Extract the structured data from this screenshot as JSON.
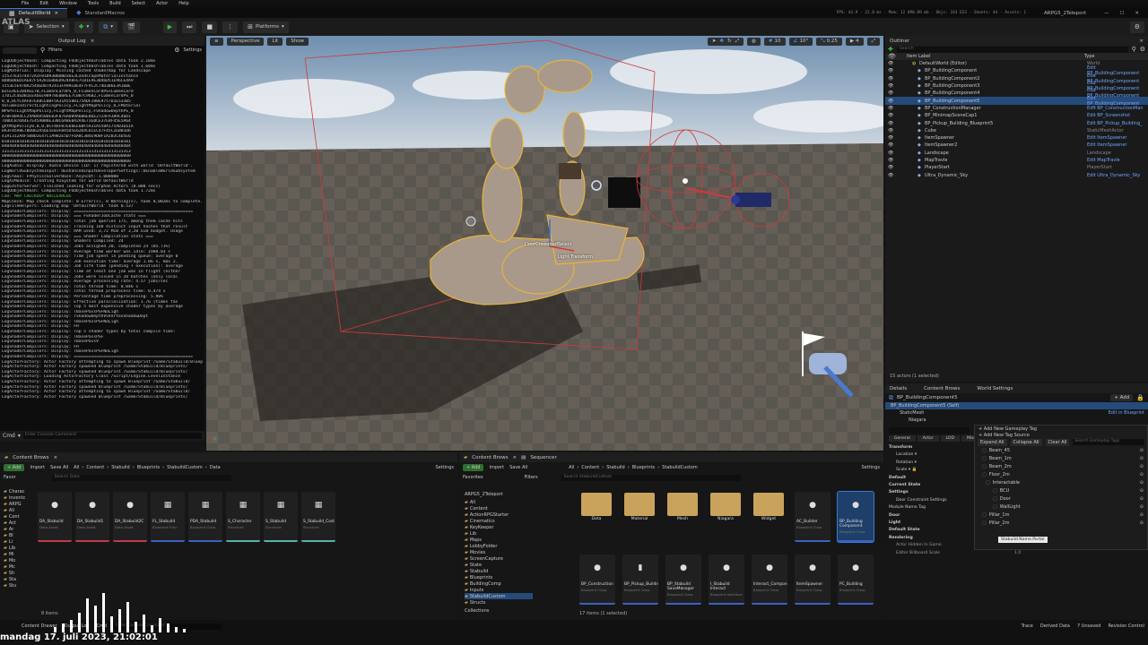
{
  "menu": [
    "File",
    "Edit",
    "Window",
    "Tools",
    "Build",
    "Select",
    "Actor",
    "Help"
  ],
  "tabs": {
    "level": "DefaultWorld",
    "macros": "StandardMacros"
  },
  "project": "ARPG5_2Teleport",
  "stats": "FPS: 43.9 · 22.8 ms · Mem: 12 090.89 mb · Objs: 243 623 · Sheets: 44 · Assets: 1",
  "toolbar": {
    "platforms": "Platforms",
    "select": "Selection"
  },
  "output_log": {
    "title": "Output Log",
    "filters": "Filters",
    "settings": "Settings",
    "cmd": "Cmd",
    "cmd_placeholder": "Enter Console Command",
    "lines": [
      "LogUObjectHash: Compacting FUObjectHashTables data took   2.18ms",
      "LogUObjectHash: Compacting FUObjectHashTables data took   1.68ms",
      "LogMaterial: Display: Missing cached shadermap for Landscape",
      "1553763574472A3F81B93B6DBD36E3LandscapeMaterialInstance",
      "8D86B8ED1AE87F5A281EB8ED924A8FE7CB1E9E3B46D51E96CE4A9",
      "1553E5E97BA2544ED87A2413FA9ACBE4F7F9C2C74D3B6E3A16BE",
      "B2CE4EE204AEE7B,FLumenCardPS_0,FLumenCardPS<LumenCard",
      "17D12C4EDB1EE46EE9B978E0BAEE7C0B7C96B2,FLumenCardPS_0",
      "0_0,DCYC4AFB7E68CE0BF5A31A558B175ADF280E9757D1E53305",
      "VolumeIndirectLightingPolicy,FLightMapPolicy_0,FMaterial",
      "NPSPolLightMapPolicy,FLightMapPolicy,FShadowDepthPS_0",
      "A7BF8DA4CC29ABAA50DE83F876AD89A6B6E86E2724FA3B9C46D1",
      "7D0DCB7DA4E7E45A0B8E33BC6A0EBA2A4E73E0CE37E8F45E5A64",
      "ghtMapPolicy0,0,0,0CF46FB7E68EE6BF5A31A558A175AD3E61A",
      "DA3F05A8E7BDB62A56E5E03FB45D5E62D4C6CEC47F45C2EBB1D6",
      "41A1312A4F5B8D2E47C1A9B2E5D7F6A8C3B4E9D0F1A2B3C4D5E6",
      "0101010101010101010101010101010101010101010101010101",
      "0404040404040404040404040404040404040404040404040404",
      "1313131313131313131313131313131313131313131313131313",
      "0000000000000000000000000000000000000000000000000000",
      "0000000000000000000000000000000000000000000000000000",
      "LogAudio: Display: Audio Device (ID: 1) registered with world 'DefaultWorld'.",
      "LogWorldSubsystemInput: UEnhancedInputDeveloperSettings::bEnableWorldSubsystem",
      "LogChaos: FPhysicsSolverBase::AsyncDt:-1.000000",
      "LogAIModule: Creating AISystem for world DefaultWorld",
      "LogEditorServer: Finished looking for orphan Actors (0.000 secs)",
      "LogUObjectHash: Compacting FUObjectHashTables data took   1.72ms",
      "Cmd: MAP CHECKDEP NOCLEARLOG",
      "MapCheck: Map check complete: 0 Error(s), 0 Warning(s), took 0,082ms to complete.",
      "LogFileHelpers: Loading map 'DefaultWorld' took 0.537",
      "LogShaderCompilers: Display: ================================================",
      "LogShaderCompilers: Display: === FShaderJobCache stats ===",
      "LogShaderCompilers: Display: Total job queries 175, among them cache hits",
      "LogShaderCompilers: Display: Tracking 160 distinct input hashes that result",
      "LogShaderCompilers: Display: RAM used: 3,72 MiB of 3,20 GiB budget. Usage",
      "LogShaderCompilers: Display: === Shader Compilation stats ===",
      "LogShaderCompilers: Display: Shaders Compiled: 24",
      "LogShaderCompilers: Display: Jobs assigned 20, completed 24 (85.71%)",
      "LogShaderCompilers: Display: Average time worker was idle: 1988.03 s",
      "LogShaderCompilers: Display: Time job spent in pending queue: average 0",
      "LogShaderCompilers: Display: Job execution time: average 1.06 s, max 2.",
      "LogShaderCompilers: Display: Job life time (pending + execution): average",
      "LogShaderCompilers: Display: Time at least one job was in flight (either",
      "LogShaderCompilers: Display: Jobs were issued in 20 batches (only local",
      "LogShaderCompilers: Display: Average processing rate: 4.57 jobs/sec",
      "LogShaderCompilers: Display: Total thread time: 8.046 s",
      "LogShaderCompilers: Display: Total thread preprocess time: 0,474 s",
      "LogShaderCompilers: Display: Percentage time preprocessing: 5.90%",
      "LogShaderCompilers: Display: Effective parallelization: 1.76 (times fas",
      "LogShaderCompilers: Display: Top 5 most expensive shader types by average",
      "LogShaderCompilers: Display:                                  TBasePassPSFNoLigh",
      "LogShaderCompilers: Display:                    TShadowDepthVSVertexShadowDept",
      "LogShaderCompilers: Display:                                  TBasePassPSFNoLigh",
      "LogShaderCompilers: Display:                                                  FH",
      "LogShaderCompilers: Display: Top 5 shader types by total compile time:",
      "LogShaderCompilers: Display:                                  TBasePassPSF",
      "LogShaderCompilers: Display:                                           TBasePassV",
      "LogShaderCompilers: Display:                                                  FH",
      "LogShaderCompilers: Display:                                  TBasePassPSFNoLigh",
      "LogShaderCompilers: Display: ================================================",
      "LogActorFactory: Actor Factory attempting to spawn Blueprint'/Game/Stabuild/Blueprint",
      "LogActorFactory: Actor Factory spawned Blueprint /Game/Stabuild/Blueprints/",
      "LogActorFactory: Actor Factory spawned Blueprint /Game/Stabuild/Blueprints/",
      "LogActorFactory: Loading ActorFactory Class /Script/Engine.LevelInstance",
      "LogActorFactory: Actor Factory attempting to spawn Blueprint'/Game/Stabuild/",
      "LogActorFactory: Actor Factory spawned Blueprint /Game/Stabuild/Blueprints/",
      "LogActorFactory: Actor Factory attempting to spawn Blueprint'/Game/Stabuild/",
      "LogActorFactory: Actor Factory spawned Blueprint /Game/Stabuild/Blueprints/"
    ]
  },
  "viewport": {
    "perspective": "Perspective",
    "lit": "Lit",
    "show": "Show",
    "grid_snap": "10",
    "rot_snap": "10°",
    "scale_snap": "0.25",
    "cam_speed": "4",
    "label_door": "DoorCrossroadSelect",
    "label_transform": "Light Transform"
  },
  "outliner": {
    "title": "Outliner",
    "search_placeholder": "Search",
    "col_label": "Item Label",
    "col_type": "Type",
    "rows": [
      {
        "name": "DefaultWorld (Editor)",
        "type": "World"
      },
      {
        "name": "BP_BuildingComponent",
        "type": "Edit BP_BuildingComponent"
      },
      {
        "name": "BP_BuildingComponent2",
        "type": "Edit BP_BuildingComponent"
      },
      {
        "name": "BP_BuildingComponent3",
        "type": "Edit BP_BuildingComponent"
      },
      {
        "name": "BP_BuildingComponent4",
        "type": "Edit BP_BuildingComponent"
      },
      {
        "name": "BP_BuildingComponent5",
        "type": "Edit BP_BuildingComponent"
      },
      {
        "name": "BP_ConstructionManager",
        "type": "Edit BP_ConstructionMan"
      },
      {
        "name": "BP_MinimapSceneCap1",
        "type": "Edit BP_Screenshot"
      },
      {
        "name": "BP_Pickup_Building_Blueprint5",
        "type": "Edit BP_Pickup_Building_"
      },
      {
        "name": "Cube",
        "type": "StaticMeshActor"
      },
      {
        "name": "ItemSpawner",
        "type": "Edit ItemSpawner"
      },
      {
        "name": "ItemSpawner2",
        "type": "Edit ItemSpawner"
      },
      {
        "name": "Landscape",
        "type": "Landscape"
      },
      {
        "name": "MapTravle",
        "type": "Edit MapTravle"
      },
      {
        "name": "PlayerStart",
        "type": "PlayerStart"
      },
      {
        "name": "Ultra_Dynamic_Sky",
        "type": "Edit Ultra_Dynamic_Sky"
      }
    ],
    "count": "15 actors (1 selected)"
  },
  "details": {
    "tabs": [
      "Details",
      "Content Brows",
      "World Settings"
    ],
    "object": "BP_BuildingComponent5",
    "self": "BP_BuildingComponent5 (Self)",
    "add": "+ Add",
    "comp_static": "StaticMesh",
    "comp_niagara": "Niagara",
    "edit_bp": "Edit in Blueprint",
    "cat_tabs": [
      "General",
      "Actor",
      "LOD",
      "Misc"
    ],
    "transform": "Transform",
    "location": "Location",
    "rotation": "Rotation",
    "scale": "Scale",
    "sections": [
      "Default",
      "Current State",
      "Settings",
      "Door",
      "Light",
      "Default State",
      "Rendering"
    ],
    "door_constraint": "Door Constraint Settings",
    "module_tag": "Module Name Tag",
    "edit": "Edit",
    "tag_value": "Stabuild.Name.Portal",
    "actor_hidden": "Actor Hidden In Game",
    "billboard": "Editor Billboard Scale",
    "billboard_val": "1.0"
  },
  "tag_dropdown": {
    "add_tag": "Add New Gameplay Tag",
    "add_source": "Add New Tag Source",
    "expand": "Expand All",
    "collapse": "Collapse All",
    "clear": "Clear All",
    "search_placeholder": "Search Gameplay Tags",
    "items": [
      "Beam_45",
      "Beam_1m",
      "Beam_2m",
      "Floor_2m",
      "Interactable",
      "BCU",
      "Door",
      "WallLight",
      "Pillar_1m",
      "Pillar_2m"
    ],
    "selected_tooltip": "Stabuild.Name.Portal"
  },
  "cb_left": {
    "title": "Content Brows",
    "add": "+ Add",
    "import": "Import",
    "save_all": "Save All",
    "settings": "Settings",
    "path": [
      "All",
      "Content",
      "Stabuild",
      "Blueprints",
      "StabuildCustom",
      "Data"
    ],
    "favorites": "Favor",
    "search_placeholder": "Search Data",
    "tree": [
      "Charac",
      "Inventc",
      "ARPG",
      "All",
      "Cont",
      "Act",
      "Ar",
      "Bl",
      "Li",
      "Lib",
      "Mi",
      "Mo",
      "Mc",
      "Sh",
      "Sta",
      "Stu"
    ],
    "items_count": "8 items",
    "assets": [
      {
        "name": "DA_Stabuild",
        "sub": "Data Asset",
        "color": "#c23a4a"
      },
      {
        "name": "DA_Stabuild1",
        "sub": "Data Asset",
        "color": "#c23a4a"
      },
      {
        "name": "DA_Stabuild2C",
        "sub": "Data Asset",
        "color": "#c23a4a"
      },
      {
        "name": "FL_Stabuild",
        "sub": "Blueprint Func",
        "color": "#3a62c2"
      },
      {
        "name": "PDA_Stabuild",
        "sub": "Blueprint Class",
        "color": "#3a62c2"
      },
      {
        "name": "S_Character",
        "sub": "Structure",
        "color": "#5ab3a4"
      },
      {
        "name": "S_Stabuild",
        "sub": "Structure",
        "color": "#5ab3a4"
      },
      {
        "name": "S_Stabuild_Cost",
        "sub": "Structure",
        "color": "#5ab3a4"
      }
    ]
  },
  "cb_right": {
    "title": "Content Brows",
    "sequencer": "Sequencer",
    "add": "+ Add",
    "import": "Import",
    "save_all": "Save All",
    "settings": "Settings",
    "path": [
      "All",
      "Content",
      "Stabuild",
      "Blueprints",
      "StabuildCustom"
    ],
    "favorites": "Favorites",
    "project": "ARPG5_2Teleport",
    "filters": "Filters",
    "search_placeholder": "Search StabuildCustom",
    "tree": [
      "All",
      "Content",
      "ActionRPGStarter",
      "Cinematics",
      "KeyKeeper",
      "Lib",
      "Maps",
      "LobbyFolder",
      "Movies",
      "ScreenCapture",
      "State",
      "Stabuild",
      "Blueprints",
      "BuildingComp",
      "Inputs",
      "StabuildCustom",
      "Structs"
    ],
    "collections": "Collections",
    "items_count": "17 items (1 selected)",
    "folders": [
      "Data",
      "Material",
      "Mesh",
      "Niagara",
      "Widget"
    ],
    "assets": [
      {
        "name": "AC_Builder",
        "sub": "Blueprint Class"
      },
      {
        "name": "BP_Building Component",
        "sub": "Blueprint Class"
      },
      {
        "name": "BP_Construction",
        "sub": "Blueprint Class"
      },
      {
        "name": "BP_Pickup_Building",
        "sub": "Blueprint Class"
      },
      {
        "name": "BP_Stabuild SaveManager",
        "sub": "Blueprint Class"
      },
      {
        "name": "I_Stabuild Interact",
        "sub": "Blueprint Interface"
      },
      {
        "name": "Interact_Component",
        "sub": "Blueprint Class"
      },
      {
        "name": "ItemSpawner",
        "sub": "Blueprint Class"
      },
      {
        "name": "PC_Building",
        "sub": "Blueprint Class"
      }
    ]
  },
  "status": {
    "drawer": "Content Drawer",
    "output": "Output Log",
    "cmd": "Cmd",
    "cmd_placeholder": "Enter Console Command",
    "trace": "Trace",
    "derived": "Derived Data",
    "unsaved": "7 Unsaved",
    "revision": "Revision Control"
  },
  "timestamp": "mandag 17. juli 2023, 21:02:01",
  "colors": {
    "accent": "#3a78d6",
    "selection": "#254b7a",
    "link": "#6ea7ff",
    "folder": "#c9a35c",
    "play": "#39c23f"
  }
}
